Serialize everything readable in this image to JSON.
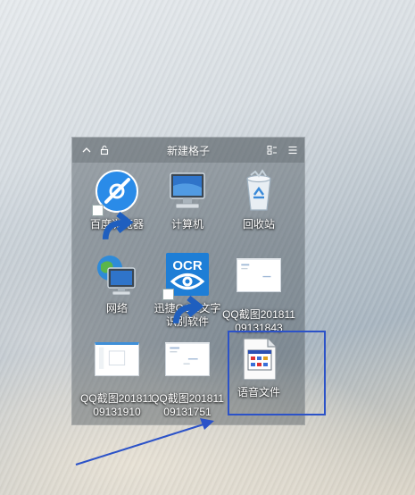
{
  "fence": {
    "title": "新建格子",
    "icons": [
      "chevron-up-icon",
      "lock-icon",
      "view-toggle-icon",
      "menu-icon"
    ]
  },
  "desktop_items": [
    {
      "label": "百度浏览器",
      "icon": "baidu-browser-icon",
      "shortcut": true
    },
    {
      "label": "计算机",
      "icon": "computer-icon",
      "shortcut": false
    },
    {
      "label": "回收站",
      "icon": "recycle-bin-icon",
      "shortcut": false
    },
    {
      "label": "网络",
      "icon": "network-icon",
      "shortcut": false
    },
    {
      "label": "迅捷OCR文字识别软件",
      "icon": "ocr-app-icon",
      "icon_text": "OCR",
      "shortcut": true
    },
    {
      "label": "QQ截图20181109131843",
      "icon": "image-thumbnail-icon",
      "shortcut": false
    },
    {
      "label": "QQ截图20181109131910",
      "icon": "image-thumbnail-icon",
      "shortcut": false
    },
    {
      "label": "QQ截图20181109131751",
      "icon": "image-thumbnail-icon",
      "shortcut": false
    },
    {
      "label": "语音文件",
      "icon": "document-file-icon",
      "shortcut": false
    }
  ],
  "colors": {
    "highlight": "#2b52c8",
    "ocr_blue": "#1e7ed6",
    "baidu_blue": "#2a8be8"
  }
}
